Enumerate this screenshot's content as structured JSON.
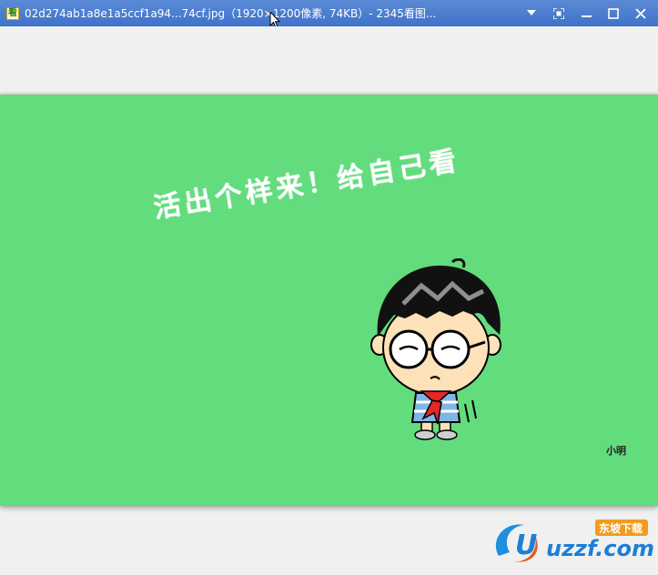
{
  "window": {
    "title": "02d274ab1a8e1a5ccf1a94...74cf.jpg（1920×1200像素, 74KB）- 2345看图...",
    "app_icon_glyph": "看",
    "controls": {
      "dropdown": "dropdown-icon",
      "fullscreen": "fullscreen-icon",
      "minimize": "minimize-icon",
      "maximize": "maximize-icon",
      "close": "close-icon"
    }
  },
  "image": {
    "background_color": "#63dc7e",
    "slogan": "活出个样来！给自己看",
    "signature": "小明"
  },
  "watermark": {
    "brand": "uzzf.com",
    "tag": "东坡下载"
  }
}
